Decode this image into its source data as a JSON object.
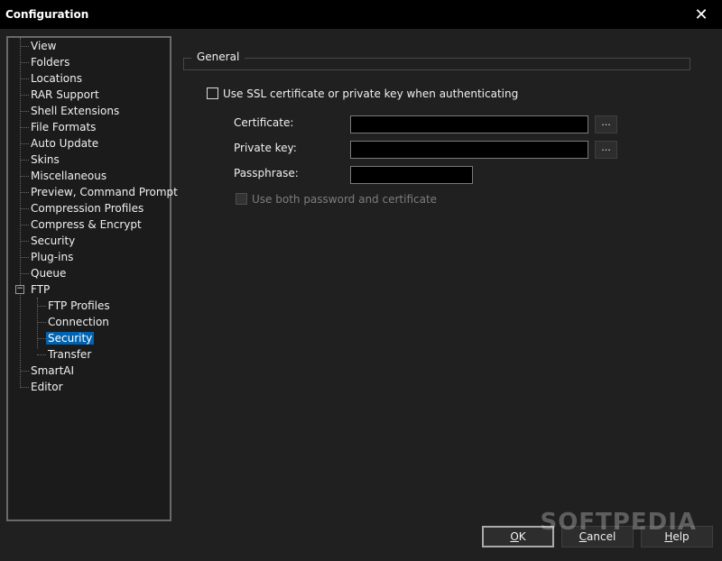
{
  "window": {
    "title": "Configuration",
    "close_icon": "close-icon"
  },
  "tree": {
    "items": [
      {
        "label": "View"
      },
      {
        "label": "Folders"
      },
      {
        "label": "Locations"
      },
      {
        "label": "RAR Support"
      },
      {
        "label": "Shell Extensions"
      },
      {
        "label": "File Formats"
      },
      {
        "label": "Auto Update"
      },
      {
        "label": "Skins"
      },
      {
        "label": "Miscellaneous"
      },
      {
        "label": "Preview, Command Prompt"
      },
      {
        "label": "Compression Profiles"
      },
      {
        "label": "Compress & Encrypt"
      },
      {
        "label": "Security"
      },
      {
        "label": "Plug-ins"
      },
      {
        "label": "Queue"
      },
      {
        "label": "FTP",
        "expanded": true,
        "expander_icon": "collapse-minus-icon"
      },
      {
        "label": "FTP Profiles"
      },
      {
        "label": "Connection"
      },
      {
        "label": "Security",
        "selected": true
      },
      {
        "label": "Transfer"
      },
      {
        "label": "SmartAI"
      },
      {
        "label": "Editor"
      }
    ]
  },
  "general": {
    "group_label": "General",
    "use_ssl": {
      "label": "Use SSL certificate or private key when authenticating",
      "checked": false
    },
    "certificate": {
      "label": "Certificate:",
      "value": "",
      "browse": "..."
    },
    "private_key": {
      "label": "Private key:",
      "value": "",
      "browse": "..."
    },
    "passphrase": {
      "label": "Passphrase:",
      "value": ""
    },
    "use_both": {
      "label": "Use both password and certificate",
      "checked": false,
      "disabled": true
    }
  },
  "buttons": {
    "ok": {
      "u": "O",
      "rest": "K"
    },
    "cancel": {
      "u": "C",
      "rest": "ancel"
    },
    "help": {
      "u": "H",
      "rest": "elp"
    }
  },
  "watermark": "SOFTPEDIA",
  "colors": {
    "selection": "#0063b1",
    "titlebar": "#000000",
    "background": "#202020"
  }
}
